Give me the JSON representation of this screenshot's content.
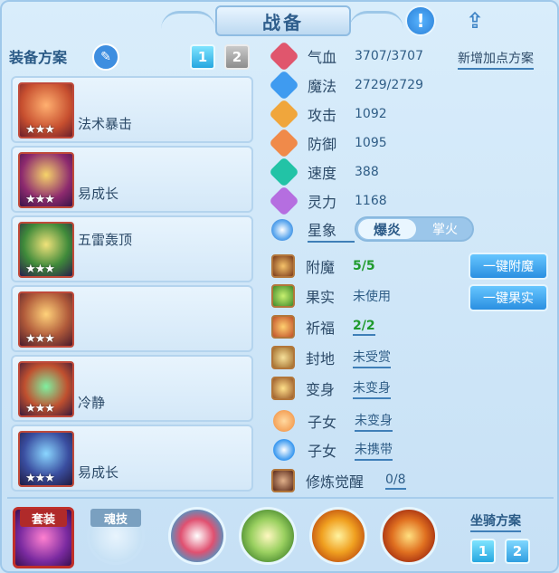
{
  "header": {
    "title": "战备",
    "info_icon": "exclamation-icon",
    "share_icon": "share-icon"
  },
  "scheme": {
    "label": "装备方案",
    "pages": [
      "1",
      "2"
    ],
    "active_page": "1"
  },
  "equipment": [
    {
      "name": "法术暴击",
      "stars": "★★★"
    },
    {
      "name": "易成长",
      "stars": "★★★"
    },
    {
      "name": "五雷轰顶",
      "stars": "★★★"
    },
    {
      "name": "",
      "stars": "★★★"
    },
    {
      "name": "冷静",
      "stars": "★★★"
    },
    {
      "name": "易成长",
      "stars": "★★★"
    }
  ],
  "stats": [
    {
      "name": "气血",
      "value": "3707/3707",
      "color": "#e0566d"
    },
    {
      "name": "魔法",
      "value": "2729/2729",
      "color": "#3f9bf0"
    },
    {
      "name": "攻击",
      "value": "1092",
      "color": "#f0a63c"
    },
    {
      "name": "防御",
      "value": "1095",
      "color": "#f08a4a"
    },
    {
      "name": "速度",
      "value": "388",
      "color": "#22c3a6"
    },
    {
      "name": "灵力",
      "value": "1168",
      "color": "#b56ee0"
    }
  ],
  "add_points_link": "新增加点方案",
  "xingxiang": {
    "label": "星象",
    "options": [
      "爆炎",
      "掌火"
    ],
    "selected": "爆炎"
  },
  "enhance": [
    {
      "name": "附魔",
      "value": "5/5",
      "value_color": "#1e9a2c"
    },
    {
      "name": "果实",
      "value": "未使用",
      "value_color": "#2f5d86"
    },
    {
      "name": "祈福",
      "value": "2/2",
      "value_color": "#1e9a2c"
    },
    {
      "name": "封地",
      "value": "未受赏",
      "value_color": "#2f5d86"
    },
    {
      "name": "变身",
      "value": "未变身",
      "value_color": "#2f5d86"
    },
    {
      "name": "子女",
      "value": "未变身",
      "value_color": "#2f5d86"
    },
    {
      "name": "子女",
      "value": "未携带",
      "value_color": "#2f5d86"
    },
    {
      "name": "修炼觉醒",
      "value": "0/8",
      "value_color": "#2f5d86"
    }
  ],
  "buttons": {
    "one_key_enchant": "一键附魔",
    "one_key_fruit": "一键果实"
  },
  "bottom": {
    "suit_label": "套装",
    "soul_skill_label": "魂技",
    "mount_label": "坐骑方案",
    "mount_pages": [
      "1",
      "2"
    ]
  }
}
